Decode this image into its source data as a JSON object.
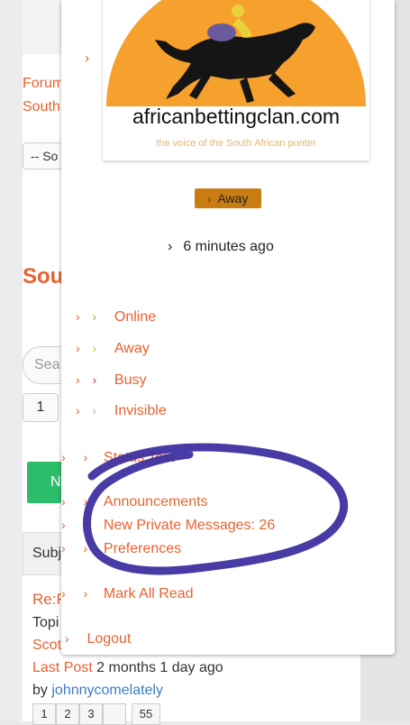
{
  "background": {
    "forum_link": "Forum",
    "south_link": "South",
    "sort_select": "-- So",
    "section_title": "Sou",
    "search_placeholder": "Sea",
    "page_first": "1",
    "tab_subject": "Subj",
    "topic_title": "Re:F",
    "topic_label": "Topi",
    "topic_author": "Scot",
    "last_post_label": "Last Post",
    "last_post_time": "2 months 1 day ago",
    "by_label": "by",
    "last_post_user": "johnnycomelately",
    "new_button": "N",
    "pager": [
      "1",
      "2",
      "3",
      "",
      "55"
    ]
  },
  "profile": {
    "logo_text": "africanbettingclan.com",
    "logo_tagline": "the voice of the South African punter",
    "status_badge": "Away",
    "last_seen": "6 minutes ago"
  },
  "status_options": [
    {
      "label": "Online",
      "color": "#8bb43a"
    },
    {
      "label": "Away",
      "color": "#d8b332"
    },
    {
      "label": "Busy",
      "color": "#c63a3a"
    },
    {
      "label": "Invisible",
      "color": "#bdbdbd"
    }
  ],
  "menu": {
    "status_text": "Status Text",
    "announcements": "Announcements",
    "private_messages": "New Private Messages: 26",
    "preferences": "Preferences",
    "mark_all_read": "Mark All Read",
    "logout": "Logout"
  },
  "colors": {
    "accent": "#e8622e",
    "annotation": "#3a2a9e"
  }
}
